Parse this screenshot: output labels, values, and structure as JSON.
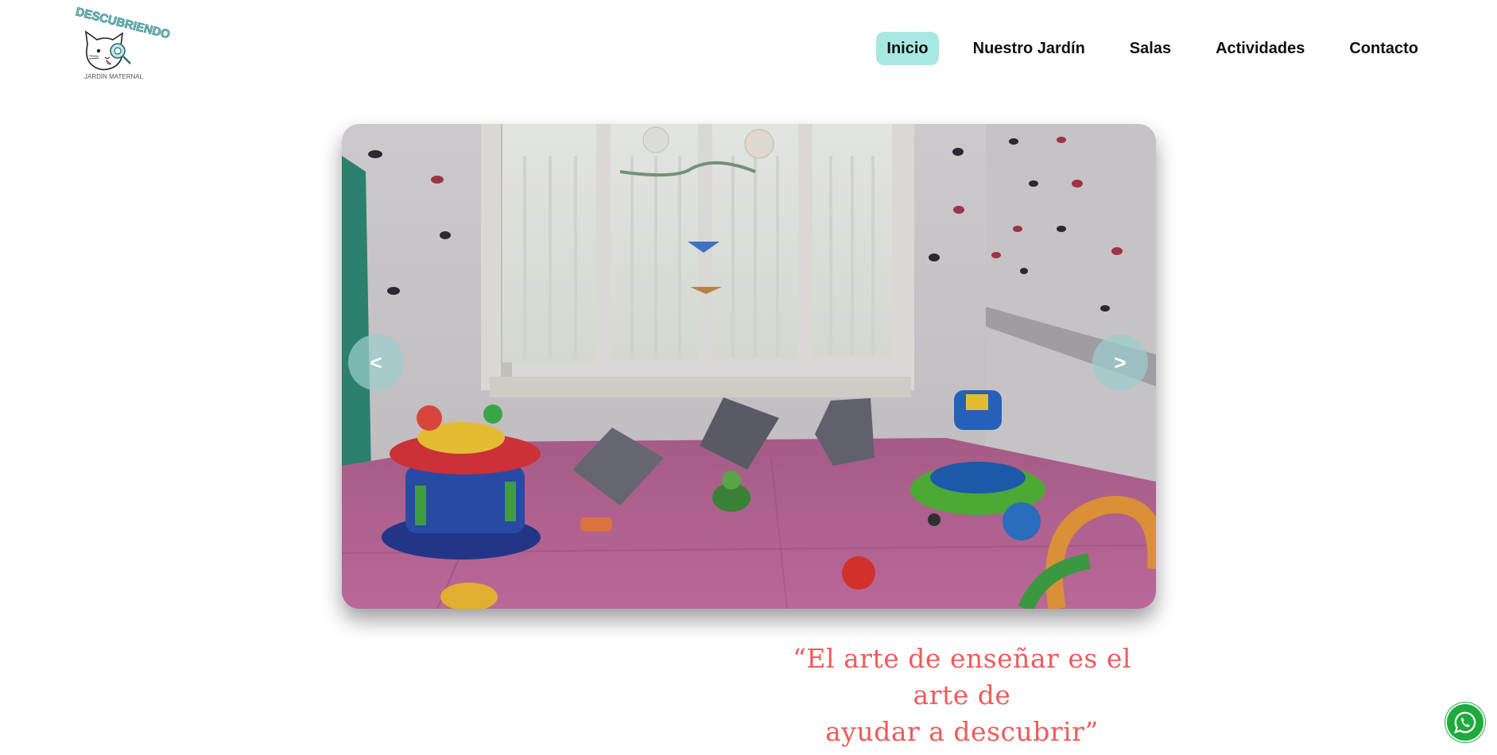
{
  "header": {
    "logo": {
      "title": "DESCUBRIENDO",
      "subtitle": "JARDÍN MATERNAL",
      "icon": "cat-logo-icon"
    },
    "nav": {
      "items": [
        {
          "label": "Inicio",
          "active": true
        },
        {
          "label": "Nuestro Jardín",
          "active": false
        },
        {
          "label": "Salas",
          "active": false
        },
        {
          "label": "Actividades",
          "active": false
        },
        {
          "label": "Contacto",
          "active": false
        }
      ]
    }
  },
  "carousel": {
    "prev_label": "<",
    "next_label": ">",
    "image": "playroom-photo"
  },
  "quote": {
    "line1": "“El arte de enseñar es el arte de",
    "line2": "ayudar a descubrir”"
  },
  "whatsapp": {
    "icon": "whatsapp-icon"
  },
  "colors": {
    "nav_active_bg": "#a8e8e2",
    "quote_color": "#ef5b5b",
    "whatsapp_green": "#1faa3e",
    "logo_teal": "#6cc7cf"
  }
}
